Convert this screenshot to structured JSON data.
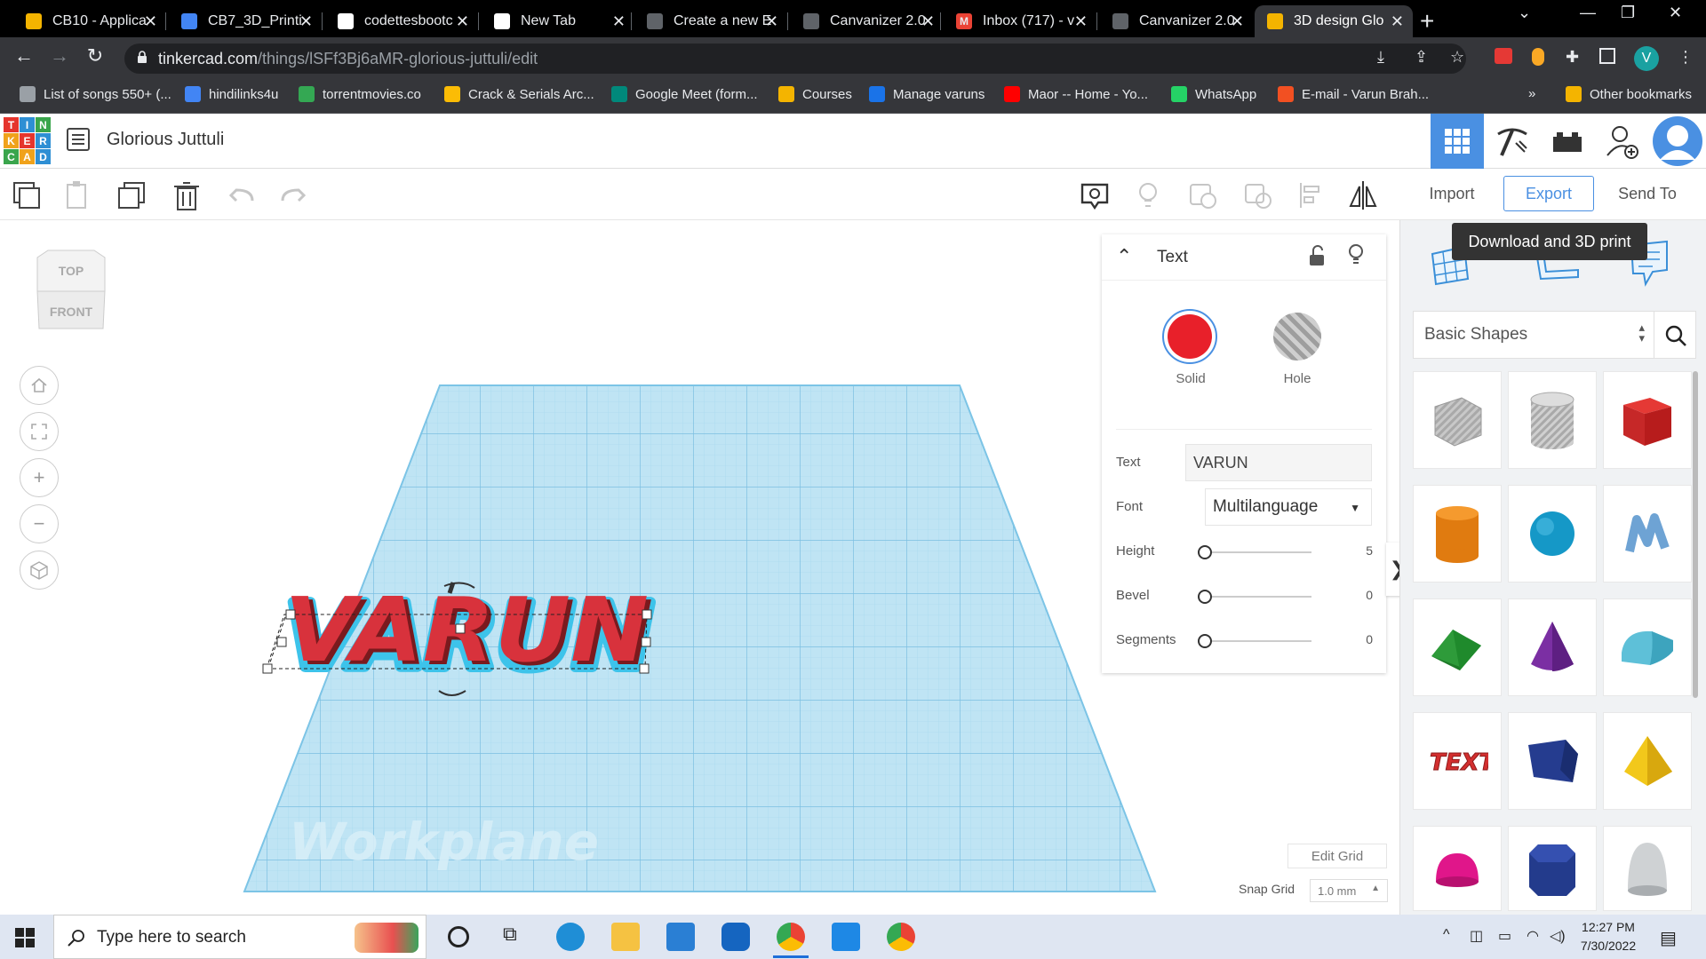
{
  "browser": {
    "tabs": [
      {
        "title": "CB10 - Applica",
        "favicon_color": "#f4b400",
        "favicon_glyph": ""
      },
      {
        "title": "CB7_3D_Printi",
        "favicon_color": "#4285f4",
        "favicon_glyph": ""
      },
      {
        "title": "codettesbootc",
        "favicon_color": "#ffffff",
        "favicon_glyph": ""
      },
      {
        "title": "New Tab",
        "favicon_color": "#ffffff",
        "favicon_glyph": ""
      },
      {
        "title": "Create a new E",
        "favicon_color": "#5f6368",
        "favicon_glyph": ""
      },
      {
        "title": "Canvanizer 2.0",
        "favicon_color": "#5f6368",
        "favicon_glyph": ""
      },
      {
        "title": "Inbox (717) - v",
        "favicon_color": "#ea4335",
        "favicon_glyph": "M"
      },
      {
        "title": "Canvanizer 2.0",
        "favicon_color": "#5f6368",
        "favicon_glyph": ""
      },
      {
        "title": "3D design Glo",
        "favicon_color": "#f4b400",
        "favicon_glyph": ""
      }
    ],
    "url_host": "tinkercad.com",
    "url_path": "/things/lSFf3Bj6aMR-glorious-juttuli/edit",
    "profile_initial": "V",
    "bookmarks": [
      {
        "label": "List of songs 550+ (...",
        "color": "#9aa0a6"
      },
      {
        "label": "hindilinks4u",
        "color": "#4285f4"
      },
      {
        "label": "torrentmovies.co",
        "color": "#34a853"
      },
      {
        "label": "Crack & Serials Arc...",
        "color": "#fbbc05"
      },
      {
        "label": "Google Meet (form...",
        "color": "#00897b"
      },
      {
        "label": "Courses",
        "color": "#f4b400"
      },
      {
        "label": "Manage varuns",
        "color": "#1a73e8"
      },
      {
        "label": "Maor -- Home - Yo...",
        "color": "#ff0000"
      },
      {
        "label": "WhatsApp",
        "color": "#25d366"
      },
      {
        "label": "E-mail - Varun Brah...",
        "color": "#f25022"
      }
    ],
    "more_bookmarks": "»",
    "other_bookmarks": "Other bookmarks"
  },
  "app": {
    "logo_letters": [
      "T",
      "I",
      "N",
      "K",
      "E",
      "R",
      "C",
      "A",
      "D"
    ],
    "design_title": "Glorious Juttuli"
  },
  "toolbar": {
    "import_label": "Import",
    "export_label": "Export",
    "send_label": "Send To",
    "tooltip": "Download and 3D print"
  },
  "viewcube": {
    "top": "TOP",
    "front": "FRONT"
  },
  "canvas": {
    "object_text": "VARUN",
    "workplane_label": "Workplane",
    "edit_grid": "Edit Grid",
    "snap_grid_label": "Snap Grid",
    "snap_grid_value": "1.0 mm"
  },
  "inspector": {
    "title": "Text",
    "solid_label": "Solid",
    "hole_label": "Hole",
    "solid_color": "#e8202a",
    "text_label": "Text",
    "text_value": "VARUN",
    "font_label": "Font",
    "font_value": "Multilanguage",
    "height_label": "Height",
    "height_value": "5",
    "height_level": 0,
    "bevel_label": "Bevel",
    "bevel_value": "0",
    "bevel_level": 0,
    "segments_label": "Segments",
    "segments_value": "0",
    "segments_level": 0
  },
  "library": {
    "category": "Basic Shapes",
    "shapes": [
      "box-hole",
      "cylinder-hole",
      "box",
      "cylinder",
      "sphere",
      "scribble",
      "roof",
      "cone",
      "round-roof",
      "text",
      "prism",
      "pyramid",
      "half-sphere",
      "polygon",
      "paraboloid"
    ]
  },
  "taskbar": {
    "search_placeholder": "Type here to search",
    "time": "12:27 PM",
    "date": "7/30/2022"
  }
}
